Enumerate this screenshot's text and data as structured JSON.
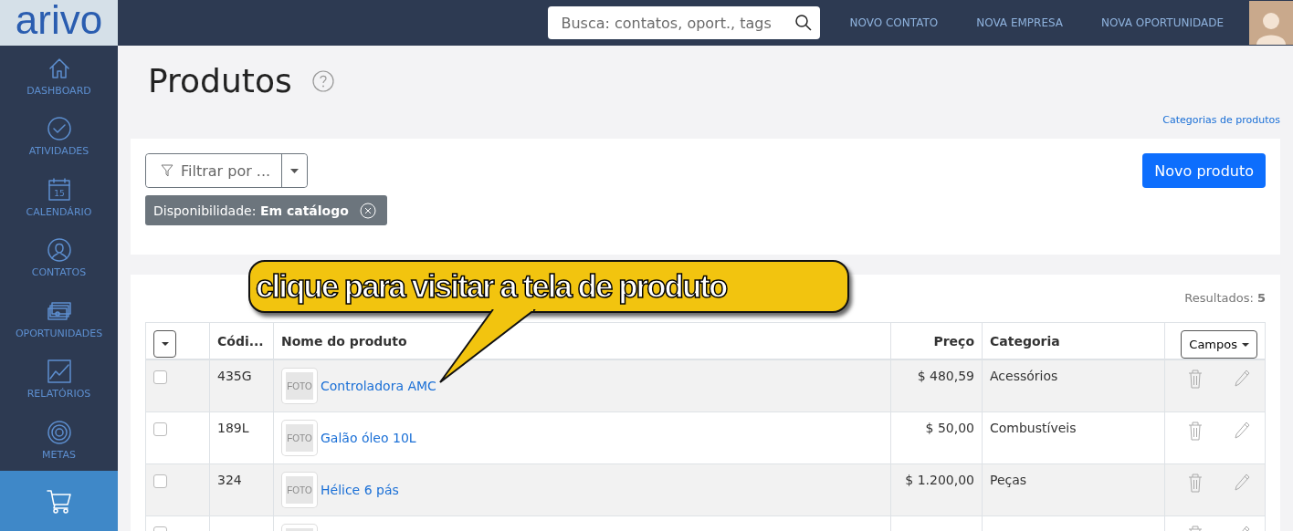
{
  "logo": "arivo",
  "sidebar": {
    "items": [
      {
        "kind": "home",
        "label": "DASHBOARD",
        "selected": false
      },
      {
        "kind": "check",
        "label": "ATIVIDADES",
        "selected": false
      },
      {
        "kind": "calendar",
        "icon_text": "15",
        "label": "CALENDÁRIO",
        "selected": false
      },
      {
        "kind": "person",
        "label": "CONTATOS",
        "selected": false
      },
      {
        "kind": "money",
        "label": "OPORTUNIDADES",
        "selected": false
      },
      {
        "kind": "chart",
        "label": "RELATÓRIOS",
        "selected": false
      },
      {
        "kind": "target",
        "label": "METAS",
        "selected": false
      },
      {
        "kind": "cart",
        "selected": true
      }
    ]
  },
  "topbar": {
    "search": {
      "placeholder": "Busca: contatos, oport., tags"
    },
    "links": [
      "NOVO CONTATO",
      "NOVA EMPRESA",
      "NOVA OPORTUNIDADE"
    ]
  },
  "page": {
    "title": "Produtos",
    "link": "Categorias de produtos"
  },
  "filters": {
    "filter_button": "Filtrar por ...",
    "chips": [
      {
        "text": "Disponibilidade: **Em catálogo**"
      }
    ],
    "new_button": "Novo produto"
  },
  "results": "Resultados: **5**",
  "table": {
    "columns": [
      {
        "kind": "text",
        "label": "Códi..."
      },
      {
        "kind": "text",
        "label": "Nome do produto"
      },
      {
        "kind": "number",
        "label": "Preço"
      },
      {
        "kind": "text",
        "label": "Categoria"
      }
    ],
    "fields_button": "Campos",
    "rows": [
      {
        "checked": false,
        "code": "435G",
        "thumb": "FOTO",
        "name": "Controladora AMC",
        "price": "$ 480,59",
        "category": "Acessórios"
      },
      {
        "checked": false,
        "code": "189L",
        "thumb": "FOTO",
        "name": "Galão óleo 10L",
        "price": "$ 50,00",
        "category": "Combustíveis"
      },
      {
        "checked": false,
        "code": "324",
        "thumb": "FOTO",
        "name": "Hélice 6 pás",
        "price": "$ 1.200,00",
        "category": "Peças"
      },
      {
        "checked": false
      }
    ]
  },
  "callout": {
    "text": "clique para visitar a tela de produto"
  }
}
